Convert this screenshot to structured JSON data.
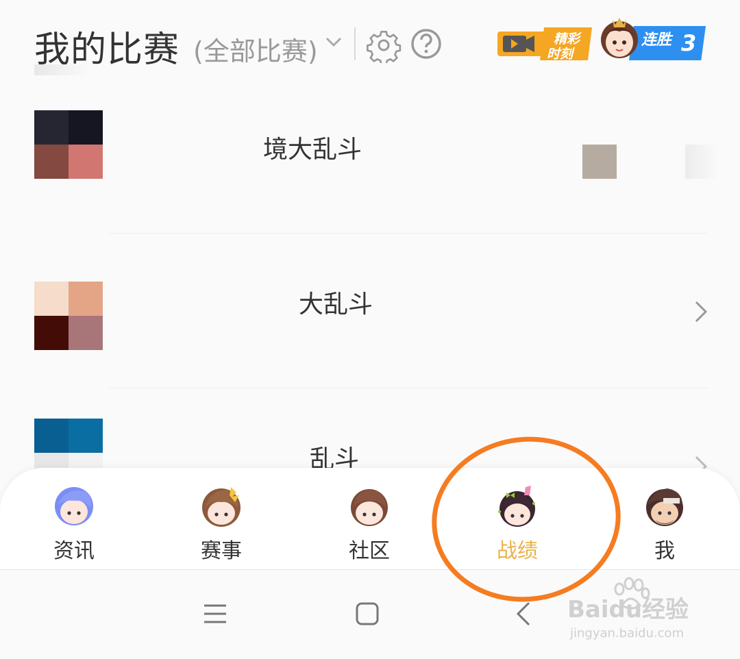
{
  "header": {
    "title": "我的比赛",
    "filter_label": "(全部比赛)",
    "highlights_line1": "精彩",
    "highlights_line2": "时刻",
    "streak_label": "连胜",
    "streak_count": "3"
  },
  "matches": [
    {
      "name": "境大乱斗"
    },
    {
      "name": "大乱斗"
    },
    {
      "name": "乱斗"
    }
  ],
  "bottom_nav": {
    "items": [
      {
        "label": "资讯"
      },
      {
        "label": "赛事"
      },
      {
        "label": "社区"
      },
      {
        "label": "战绩"
      },
      {
        "label": "我"
      }
    ],
    "active_index": 3
  },
  "watermark": {
    "brand": "Baidu经验",
    "url": "jingyan.baidu.com"
  },
  "colors": {
    "accent_active": "#e8b24a",
    "annotation_circle": "#f57c20",
    "highlights_orange": "#f5a623",
    "streak_blue": "#2d8ff0"
  },
  "icons": {
    "filter": "chevron-down-icon",
    "settings": "gear-icon",
    "help": "question-circle-icon",
    "highlights": "video-camera-icon",
    "row_arrow": "chevron-right-icon",
    "sys_menu": "menu-lines-icon",
    "sys_home": "home-square-icon",
    "sys_back": "back-chevron-icon"
  }
}
